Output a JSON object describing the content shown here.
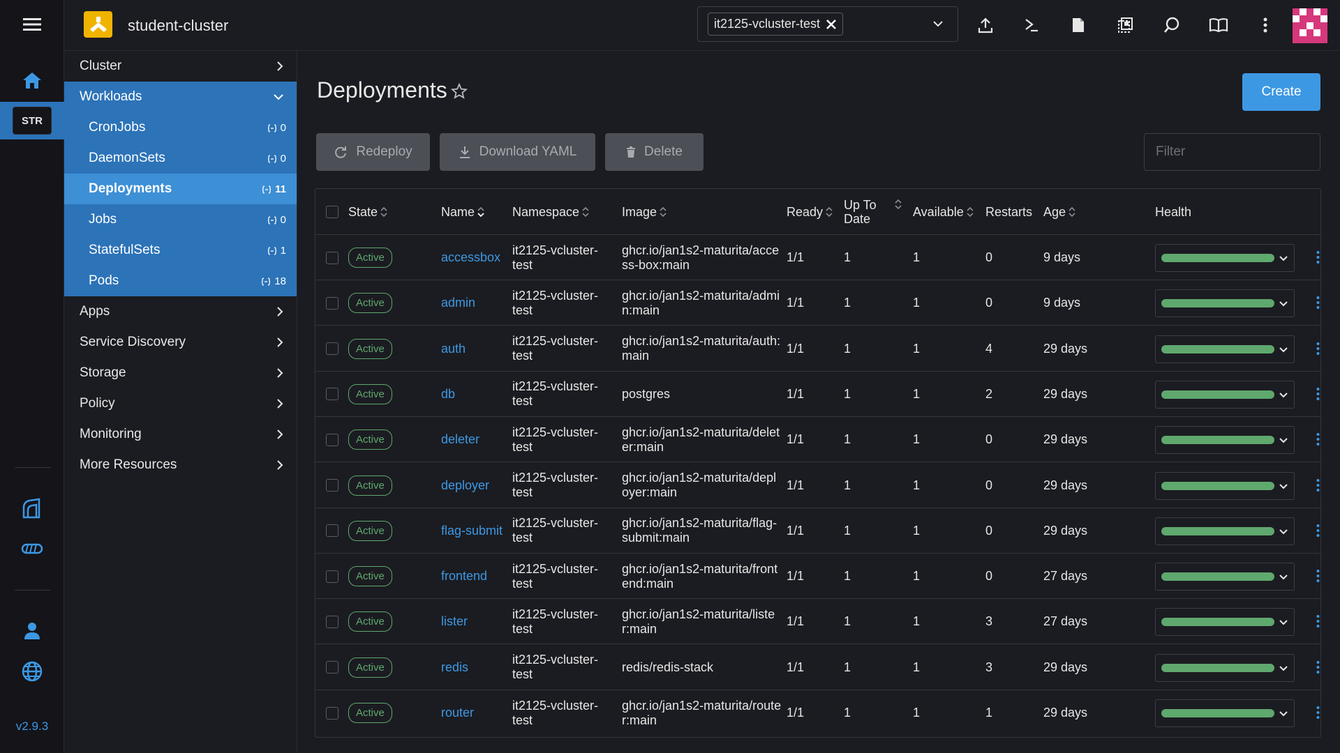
{
  "header": {
    "cluster_name": "student-cluster",
    "namespace_chip": "it2125-vcluster-test"
  },
  "rail": {
    "badge": "STR",
    "version": "v2.9.3"
  },
  "sidenav": {
    "groups_top": [
      {
        "label": "Cluster"
      }
    ],
    "workloads": {
      "label": "Workloads",
      "items": [
        {
          "label": "CronJobs",
          "count": "0"
        },
        {
          "label": "DaemonSets",
          "count": "0"
        },
        {
          "label": "Deployments",
          "count": "11"
        },
        {
          "label": "Jobs",
          "count": "0"
        },
        {
          "label": "StatefulSets",
          "count": "1"
        },
        {
          "label": "Pods",
          "count": "18"
        }
      ]
    },
    "groups_bottom": [
      {
        "label": "Apps"
      },
      {
        "label": "Service Discovery"
      },
      {
        "label": "Storage"
      },
      {
        "label": "Policy"
      },
      {
        "label": "Monitoring"
      },
      {
        "label": "More Resources"
      }
    ]
  },
  "page": {
    "title": "Deployments",
    "create_label": "Create",
    "redeploy_label": "Redeploy",
    "download_label": "Download YAML",
    "delete_label": "Delete",
    "filter_placeholder": "Filter"
  },
  "table": {
    "headers": {
      "state": "State",
      "name": "Name",
      "namespace": "Namespace",
      "image": "Image",
      "ready": "Ready",
      "uptodate": "Up To Date",
      "available": "Available",
      "restarts": "Restarts",
      "age": "Age",
      "health": "Health"
    },
    "rows": [
      {
        "state": "Active",
        "name": "accessbox",
        "namespace": "it2125-vcluster-test",
        "image": "ghcr.io/jan1s2-maturita/access-box:main",
        "ready": "1/1",
        "uptodate": "1",
        "available": "1",
        "restarts": "0",
        "age": "9 days"
      },
      {
        "state": "Active",
        "name": "admin",
        "namespace": "it2125-vcluster-test",
        "image": "ghcr.io/jan1s2-maturita/admin:main",
        "ready": "1/1",
        "uptodate": "1",
        "available": "1",
        "restarts": "0",
        "age": "9 days"
      },
      {
        "state": "Active",
        "name": "auth",
        "namespace": "it2125-vcluster-test",
        "image": "ghcr.io/jan1s2-maturita/auth:main",
        "ready": "1/1",
        "uptodate": "1",
        "available": "1",
        "restarts": "4",
        "age": "29 days"
      },
      {
        "state": "Active",
        "name": "db",
        "namespace": "it2125-vcluster-test",
        "image": "postgres",
        "ready": "1/1",
        "uptodate": "1",
        "available": "1",
        "restarts": "2",
        "age": "29 days"
      },
      {
        "state": "Active",
        "name": "deleter",
        "namespace": "it2125-vcluster-test",
        "image": "ghcr.io/jan1s2-maturita/deleter:main",
        "ready": "1/1",
        "uptodate": "1",
        "available": "1",
        "restarts": "0",
        "age": "29 days"
      },
      {
        "state": "Active",
        "name": "deployer",
        "namespace": "it2125-vcluster-test",
        "image": "ghcr.io/jan1s2-maturita/deployer:main",
        "ready": "1/1",
        "uptodate": "1",
        "available": "1",
        "restarts": "0",
        "age": "29 days"
      },
      {
        "state": "Active",
        "name": "flag-submit",
        "namespace": "it2125-vcluster-test",
        "image": "ghcr.io/jan1s2-maturita/flag-submit:main",
        "ready": "1/1",
        "uptodate": "1",
        "available": "1",
        "restarts": "0",
        "age": "29 days"
      },
      {
        "state": "Active",
        "name": "frontend",
        "namespace": "it2125-vcluster-test",
        "image": "ghcr.io/jan1s2-maturita/frontend:main",
        "ready": "1/1",
        "uptodate": "1",
        "available": "1",
        "restarts": "0",
        "age": "27 days"
      },
      {
        "state": "Active",
        "name": "lister",
        "namespace": "it2125-vcluster-test",
        "image": "ghcr.io/jan1s2-maturita/lister:main",
        "ready": "1/1",
        "uptodate": "1",
        "available": "1",
        "restarts": "3",
        "age": "27 days"
      },
      {
        "state": "Active",
        "name": "redis",
        "namespace": "it2125-vcluster-test",
        "image": "redis/redis-stack",
        "ready": "1/1",
        "uptodate": "1",
        "available": "1",
        "restarts": "3",
        "age": "29 days"
      },
      {
        "state": "Active",
        "name": "router",
        "namespace": "it2125-vcluster-test",
        "image": "ghcr.io/jan1s2-maturita/router:main",
        "ready": "1/1",
        "uptodate": "1",
        "available": "1",
        "restarts": "1",
        "age": "29 days"
      }
    ]
  },
  "colors": {
    "accent": "#3d98e3",
    "nav_active": "#2c73b8",
    "status_green": "#5fa86e",
    "brand_yellow": "#f0b400"
  }
}
